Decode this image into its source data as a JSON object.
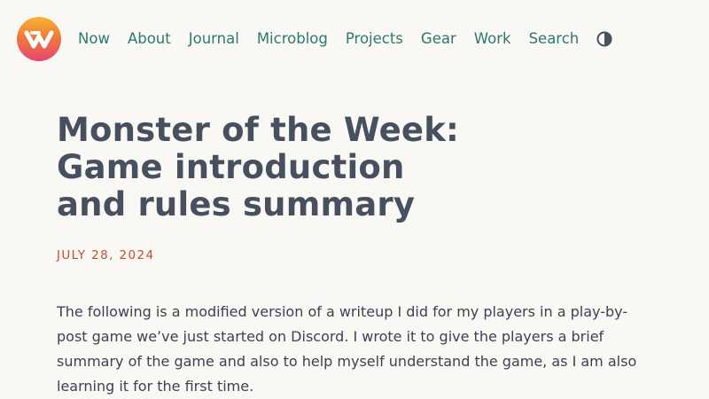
{
  "header": {
    "logo_name": "site-logo",
    "nav": [
      {
        "label": "Now"
      },
      {
        "label": "About"
      },
      {
        "label": "Journal"
      },
      {
        "label": "Microblog"
      },
      {
        "label": "Projects"
      },
      {
        "label": "Gear"
      },
      {
        "label": "Work"
      },
      {
        "label": "Search"
      }
    ],
    "theme_toggle_icon": "half-circle-contrast-icon"
  },
  "article": {
    "title_line1": "Monster of the Week:",
    "title_line2": "Game introduction",
    "title_line3": "and rules summary",
    "date": "JULY 28, 2024",
    "intro": "The following is a modified version of a writeup I did for my players in a play-by-post game we’ve just started on Discord. I wrote it to give the players a brief summary of the game and also to help myself understand the game, as I am also learning it for the first time."
  },
  "colors": {
    "background": "#f9f8f5",
    "nav_link": "#2c7a6c",
    "title": "#47505f",
    "date": "#c0502e",
    "body_text": "#3b4250"
  }
}
